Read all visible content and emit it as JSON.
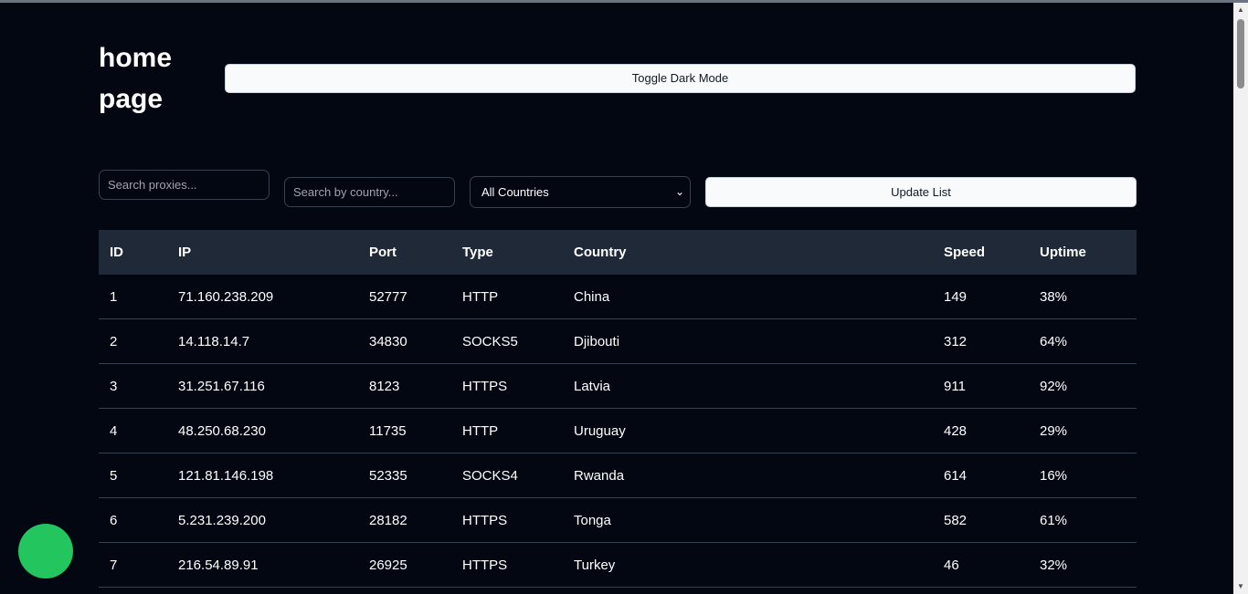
{
  "page": {
    "title": "home page",
    "toggle_label": "Toggle Dark Mode"
  },
  "filters": {
    "search_placeholder": "Search proxies...",
    "country_placeholder": "Search by country...",
    "country_select": "All Countries",
    "update_label": "Update List"
  },
  "table": {
    "columns": [
      "ID",
      "IP",
      "Port",
      "Type",
      "Country",
      "Speed",
      "Uptime"
    ],
    "rows": [
      [
        "1",
        "71.160.238.209",
        "52777",
        "HTTP",
        "China",
        "149",
        "38%"
      ],
      [
        "2",
        "14.118.14.7",
        "34830",
        "SOCKS5",
        "Djibouti",
        "312",
        "64%"
      ],
      [
        "3",
        "31.251.67.116",
        "8123",
        "HTTPS",
        "Latvia",
        "911",
        "92%"
      ],
      [
        "4",
        "48.250.68.230",
        "11735",
        "HTTP",
        "Uruguay",
        "428",
        "29%"
      ],
      [
        "5",
        "121.81.146.198",
        "52335",
        "SOCKS4",
        "Rwanda",
        "614",
        "16%"
      ],
      [
        "6",
        "5.231.239.200",
        "28182",
        "HTTPS",
        "Tonga",
        "582",
        "61%"
      ],
      [
        "7",
        "216.54.89.91",
        "26925",
        "HTTPS",
        "Turkey",
        "46",
        "32%"
      ]
    ]
  },
  "colors": {
    "background": "#030712",
    "header_row": "#1f2937",
    "accent_fab": "#22c55e"
  }
}
